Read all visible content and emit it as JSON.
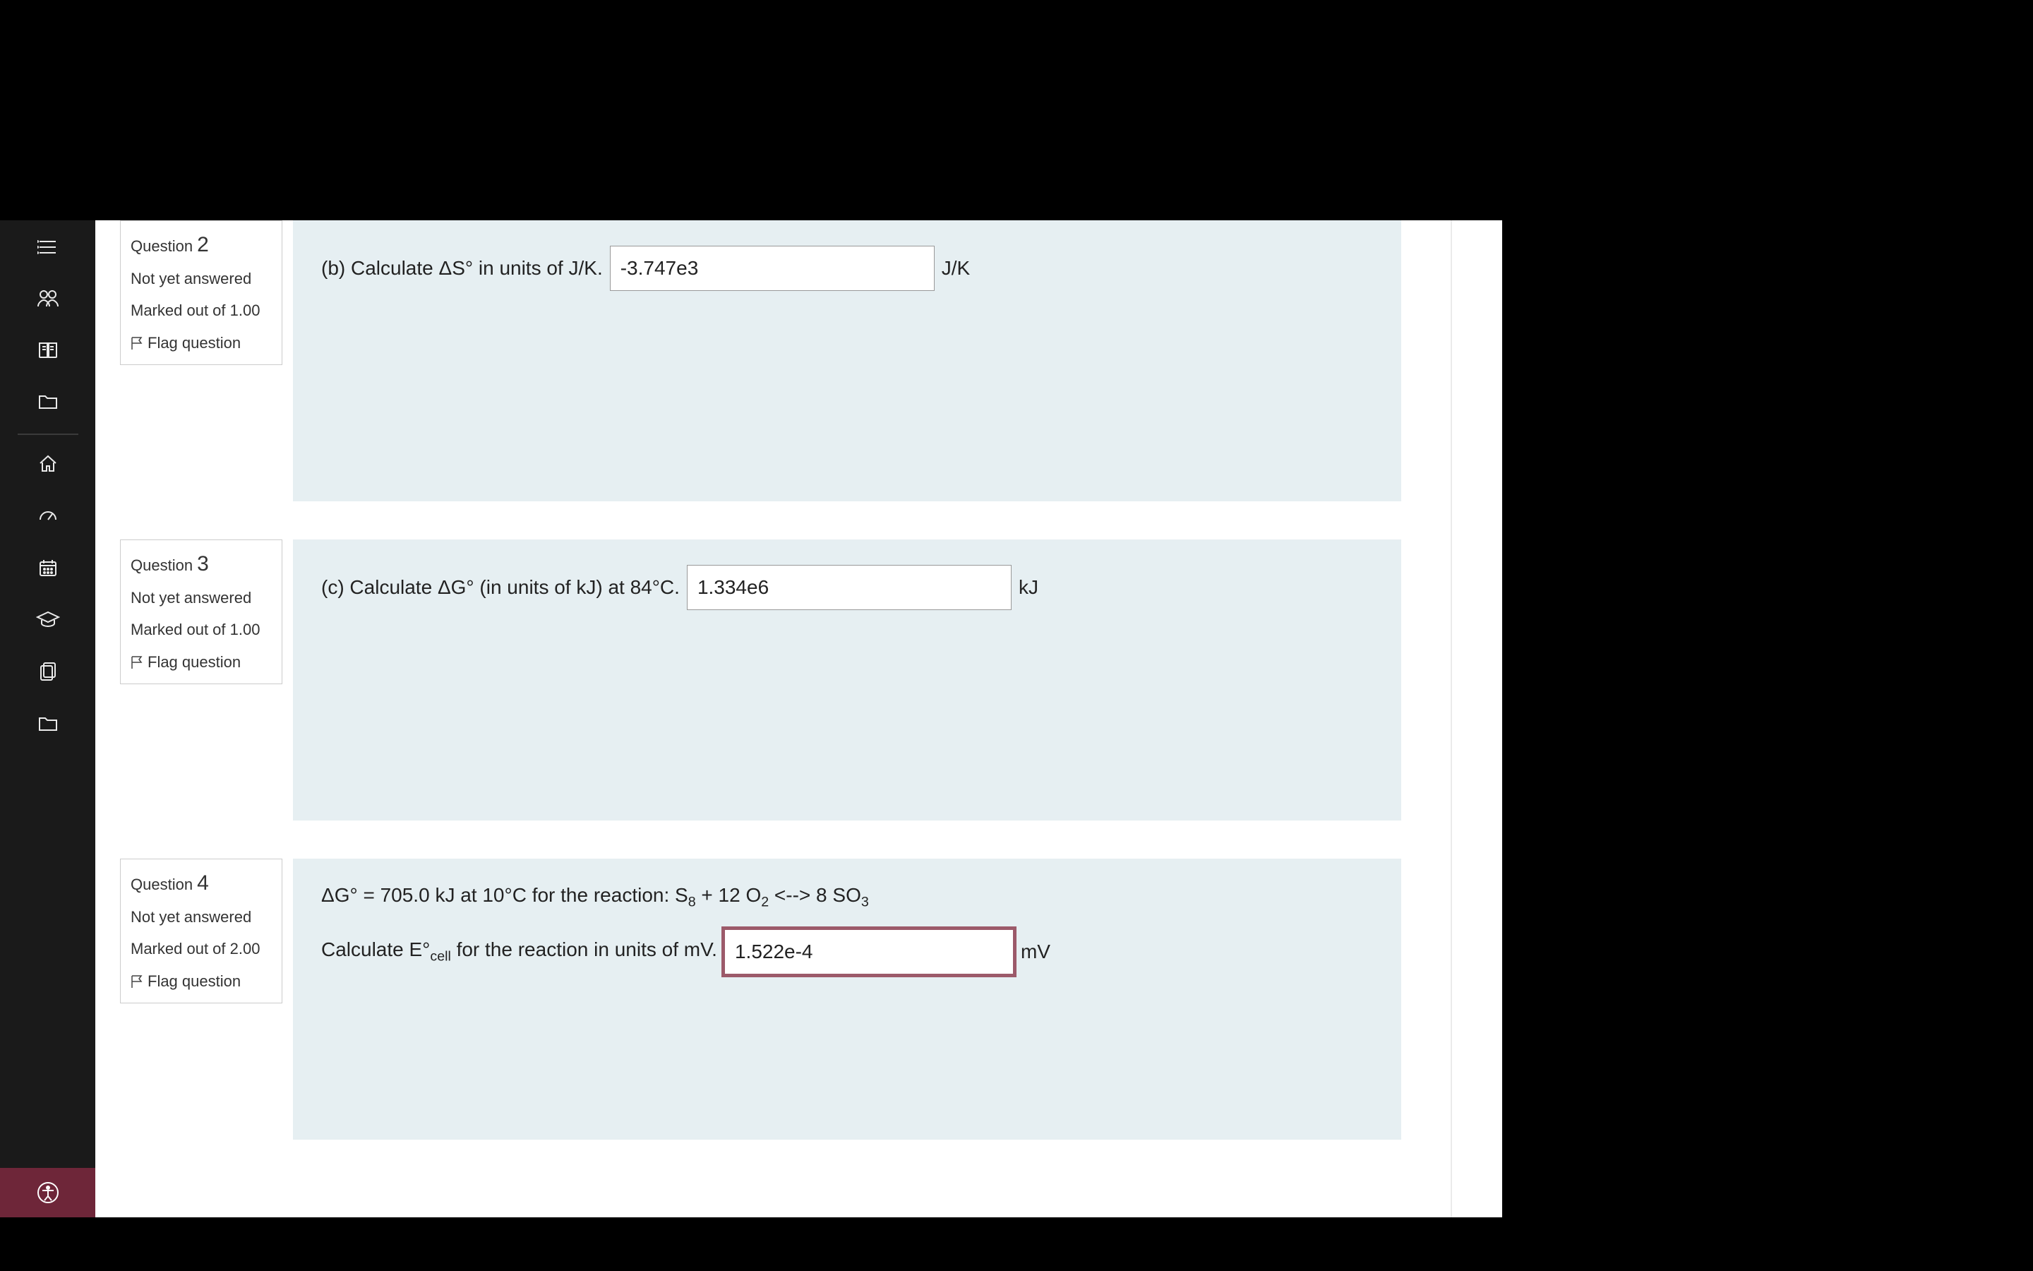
{
  "sidebar": {
    "icons": [
      "list",
      "group",
      "book",
      "folder",
      "home",
      "speed",
      "calendar",
      "grad-cap",
      "files",
      "folder2"
    ],
    "accessibility": "accessibility"
  },
  "questions": [
    {
      "number": "2",
      "title_prefix": "Question ",
      "status": "Not yet answered",
      "marked_prefix": "Marked out of ",
      "marked_value": "1.00",
      "flag": "Flag question",
      "prompt_prefix": "(b)  Calculate ΔS° in units of J/K.",
      "answer_value": "-3.747e3",
      "unit": "J/K"
    },
    {
      "number": "3",
      "title_prefix": "Question ",
      "status": "Not yet answered",
      "marked_prefix": "Marked out of ",
      "marked_value": "1.00",
      "flag": "Flag question",
      "prompt_prefix": "(c)  Calculate ΔG° (in units of kJ) at 84°C.",
      "answer_value": "1.334e6",
      "unit": "kJ"
    },
    {
      "number": "4",
      "title_prefix": "Question ",
      "status": "Not yet answered",
      "marked_prefix": "Marked out of ",
      "marked_value": "2.00",
      "flag": "Flag question",
      "line1_a": "ΔG° = 705.0 kJ at 10°C for the reaction:  S",
      "line1_sub1": "8",
      "line1_b": " + 12 O",
      "line1_sub2": "2",
      "line1_c": " <--> 8 SO",
      "line1_sub3": "3",
      "line2_a": "Calculate E°",
      "line2_sub": "cell",
      "line2_b": " for the reaction in units of mV.",
      "answer_value": "1.522e-4",
      "unit": "mV"
    }
  ]
}
